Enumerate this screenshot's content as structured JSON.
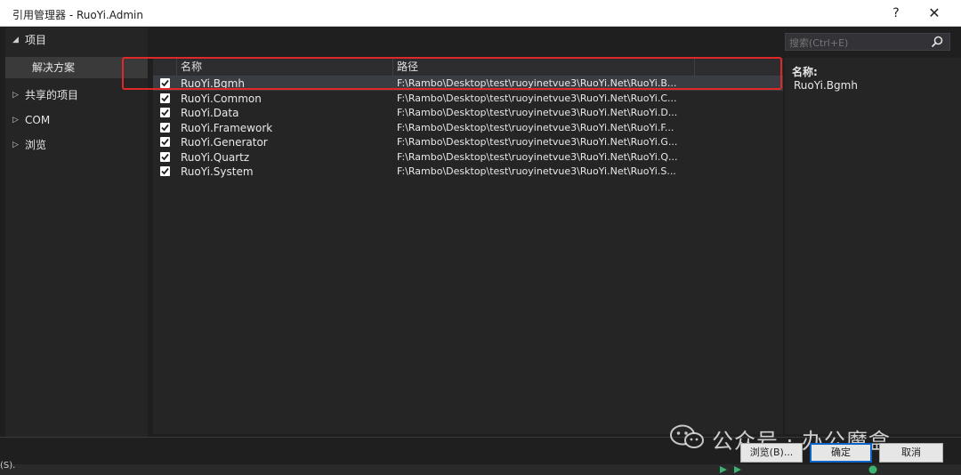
{
  "window": {
    "title": "引用管理器 - RuoYi.Admin",
    "help": "?",
    "close": "✕"
  },
  "sidebar": {
    "items": [
      {
        "label": "项目",
        "arrow": "◢"
      },
      {
        "label": "解决方案"
      },
      {
        "label": "共享的项目",
        "arrow": "▷"
      },
      {
        "label": "COM",
        "arrow": "▷"
      },
      {
        "label": "浏览",
        "arrow": "▷"
      }
    ]
  },
  "table": {
    "columns": [
      "名称",
      "路径"
    ],
    "rows": [
      {
        "name": "RuoYi.Bgmh",
        "path": "F:\\Rambo\\Desktop\\test\\ruoyinetvue3\\RuoYi.Net\\RuoYi.B...",
        "checked": true
      },
      {
        "name": "RuoYi.Common",
        "path": "F:\\Rambo\\Desktop\\test\\ruoyinetvue3\\RuoYi.Net\\RuoYi.C...",
        "checked": true
      },
      {
        "name": "RuoYi.Data",
        "path": "F:\\Rambo\\Desktop\\test\\ruoyinetvue3\\RuoYi.Net\\RuoYi.D...",
        "checked": true
      },
      {
        "name": "RuoYi.Framework",
        "path": "F:\\Rambo\\Desktop\\test\\ruoyinetvue3\\RuoYi.Net\\RuoYi.F...",
        "checked": true
      },
      {
        "name": "RuoYi.Generator",
        "path": "F:\\Rambo\\Desktop\\test\\ruoyinetvue3\\RuoYi.Net\\RuoYi.G...",
        "checked": true
      },
      {
        "name": "RuoYi.Quartz",
        "path": "F:\\Rambo\\Desktop\\test\\ruoyinetvue3\\RuoYi.Net\\RuoYi.Q...",
        "checked": true
      },
      {
        "name": "RuoYi.System",
        "path": "F:\\Rambo\\Desktop\\test\\ruoyinetvue3\\RuoYi.Net\\RuoYi.S...",
        "checked": true
      }
    ]
  },
  "search": {
    "placeholder": "搜索(Ctrl+E)"
  },
  "details": {
    "label": "名称:",
    "value": "RuoYi.Bgmh"
  },
  "buttons": {
    "browse": "浏览(B)...",
    "ok": "确定",
    "cancel": "取消"
  },
  "status": {
    "left_text": "(S)."
  },
  "watermark": {
    "text": "公众号 · 办公魔盒"
  },
  "colors": {
    "highlight": "#e12828",
    "accent": "#0a64c8"
  }
}
